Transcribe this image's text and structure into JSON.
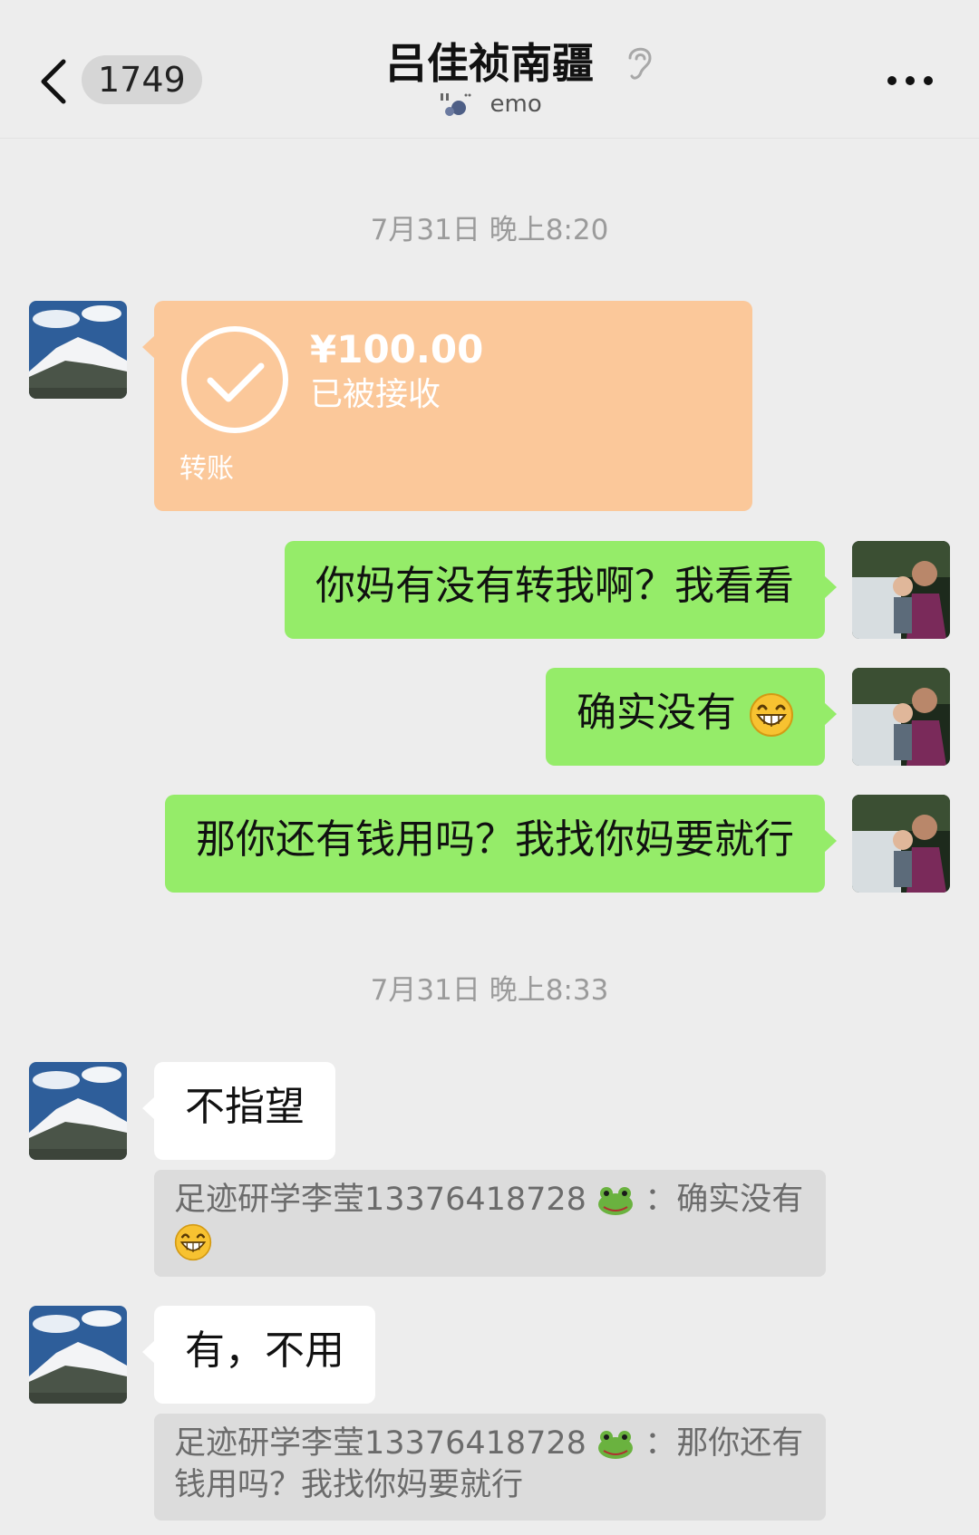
{
  "header": {
    "unread_count": "1749",
    "title": "吕佳祯南疆",
    "status": "emo"
  },
  "timestamps": [
    "7月31日 晚上8:20",
    "7月31日 晚上8:33"
  ],
  "messages": {
    "transfer": {
      "amount": "¥100.00",
      "status": "已被接收",
      "label": "转账"
    },
    "m1": "你妈有没有转我啊？我看看",
    "m2": "确实没有",
    "m3": "那你还有钱用吗？我找你妈要就行",
    "m4": "不指望",
    "q1": "足迹研学李莹13376418728",
    "q1_sep": "：确实没有",
    "m5": "有，不用",
    "q2_line1": "足迹研学李莹13376418728",
    "q2_sep": "：那你还有",
    "q2_line2": "钱用吗？我找你妈要就行"
  },
  "colors": {
    "background": "#ededed",
    "sent_bubble": "#95ec69",
    "received_bubble": "#ffffff",
    "transfer_bubble": "#fbc89a",
    "quote": "#dcdcdc"
  }
}
